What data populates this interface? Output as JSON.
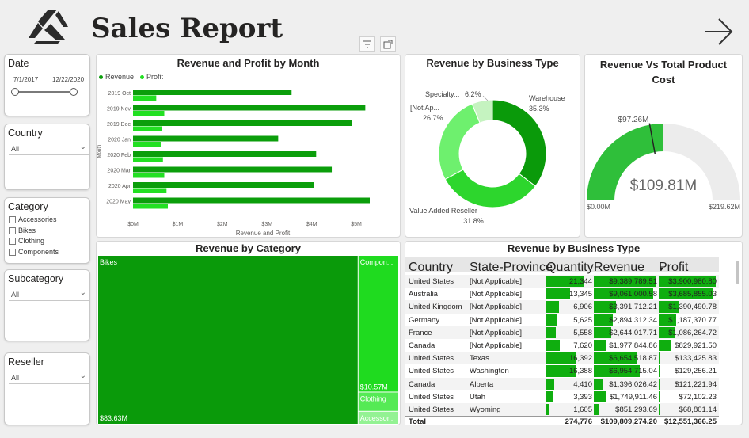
{
  "header": {
    "title": "Sales Report"
  },
  "slicers": {
    "date": {
      "title": "Date",
      "start": "7/1/2017",
      "end": "12/22/2020"
    },
    "country": {
      "title": "Country",
      "value": "All"
    },
    "category": {
      "title": "Category",
      "items": [
        "Accessories",
        "Bikes",
        "Clothing",
        "Components"
      ]
    },
    "subcategory": {
      "title": "Subcategory",
      "value": "All"
    },
    "reseller": {
      "title": "Reseller",
      "value": "All"
    }
  },
  "colors": {
    "revenue": "#0b9e0b",
    "profit": "#22e022",
    "dark_green": "#0a9a0a",
    "mid_green": "#2dd62d",
    "light_green": "#6ef06e",
    "pale_green": "#c5f3c0",
    "gauge_fill": "#2fbf3a",
    "gauge_track": "#ececec"
  },
  "chart_data": [
    {
      "type": "bar",
      "orientation": "horizontal",
      "title": "Revenue and Profit by Month",
      "xlabel": "Revenue and Profit",
      "ylabel": "Month",
      "categories": [
        "2019 Oct",
        "2019 Nov",
        "2019 Dec",
        "2020 Jan",
        "2020 Feb",
        "2020 Mar",
        "2020 Apr",
        "2020 May"
      ],
      "series": [
        {
          "name": "Revenue",
          "values": [
            3.55,
            5.2,
            4.9,
            3.25,
            4.1,
            4.45,
            4.05,
            5.3
          ]
        },
        {
          "name": "Profit",
          "values": [
            0.52,
            0.7,
            0.65,
            0.62,
            0.67,
            0.7,
            0.75,
            0.78
          ]
        }
      ],
      "xticks": [
        "$0M",
        "$1M",
        "$2M",
        "$3M",
        "$4M",
        "$5M"
      ],
      "xlim": [
        0,
        5.3
      ],
      "legend": "top-left"
    },
    {
      "type": "pie",
      "donut": true,
      "title": "Revenue by Business Type",
      "slices": [
        {
          "label": "Warehouse",
          "value": 35.3,
          "pct": "35.3%"
        },
        {
          "label": "Value Added Reseller",
          "value": 31.8,
          "pct": "31.8%"
        },
        {
          "label": "[Not Ap...",
          "value": 26.7,
          "pct": "26.7%"
        },
        {
          "label": "Specialty...",
          "value": 6.2,
          "pct": "6.2%"
        }
      ]
    },
    {
      "type": "gauge",
      "title": "Revenue Vs Total Product Cost",
      "value": 109.81,
      "value_label": "$109.81M",
      "min": 0,
      "min_label": "$0.00M",
      "max": 219.62,
      "max_label": "$219.62M",
      "target": 97.26,
      "target_label": "$97.26M"
    },
    {
      "type": "treemap",
      "title": "Revenue by Category",
      "items": [
        {
          "label": "Bikes",
          "value": 83.63,
          "value_label": "$83.63M"
        },
        {
          "label": "Compon...",
          "value": 10.57,
          "value_label": "$10.57M"
        },
        {
          "label": "Clothing",
          "value": 1.5
        },
        {
          "label": "Accessor...",
          "value": 1.0
        }
      ]
    },
    {
      "type": "table",
      "title": "Revenue by Business Type",
      "columns": [
        "Country",
        "State-Province",
        "Quantity",
        "Revenue",
        "Profit"
      ],
      "rows": [
        [
          "United States",
          "[Not Applicable]",
          "21,344",
          "$9,389,789.51",
          "$3,900,980.80"
        ],
        [
          "Australia",
          "[Not Applicable]",
          "13,345",
          "$9,061,000.58",
          "$3,685,855.03"
        ],
        [
          "United Kingdom",
          "[Not Applicable]",
          "6,906",
          "$3,391,712.21",
          "$1,390,490.78"
        ],
        [
          "Germany",
          "[Not Applicable]",
          "5,625",
          "$2,894,312.34",
          "$1,187,370.77"
        ],
        [
          "France",
          "[Not Applicable]",
          "5,558",
          "$2,644,017.71",
          "$1,086,264.72"
        ],
        [
          "Canada",
          "[Not Applicable]",
          "7,620",
          "$1,977,844.86",
          "$829,921.50"
        ],
        [
          "United States",
          "Texas",
          "16,392",
          "$6,654,518.87",
          "$133,425.83"
        ],
        [
          "United States",
          "Washington",
          "16,388",
          "$6,954,715.04",
          "$129,256.21"
        ],
        [
          "Canada",
          "Alberta",
          "4,410",
          "$1,396,026.42",
          "$121,221.94"
        ],
        [
          "United States",
          "Utah",
          "3,393",
          "$1,749,911.46",
          "$72,102.23"
        ],
        [
          "United States",
          "Wyoming",
          "1,605",
          "$851,293.69",
          "$68,801.14"
        ]
      ],
      "bars": {
        "quantity": [
          21344,
          13345,
          6906,
          5625,
          5558,
          7620,
          16392,
          16388,
          4410,
          3393,
          1605
        ],
        "revenue": [
          9389789.51,
          9061000.58,
          3391712.21,
          2894312.34,
          2644017.71,
          1977844.86,
          6654518.87,
          6954715.04,
          1396026.42,
          1749911.46,
          851293.69
        ],
        "profit": [
          3900980.8,
          3685855.03,
          1390490.78,
          1187370.77,
          1086264.72,
          829921.5,
          133425.83,
          129256.21,
          121221.94,
          72102.23,
          68801.14
        ]
      },
      "total": {
        "label": "Total",
        "quantity": "274,776",
        "revenue": "$109,809,274.20",
        "profit": "$12,551,366.25"
      }
    }
  ]
}
